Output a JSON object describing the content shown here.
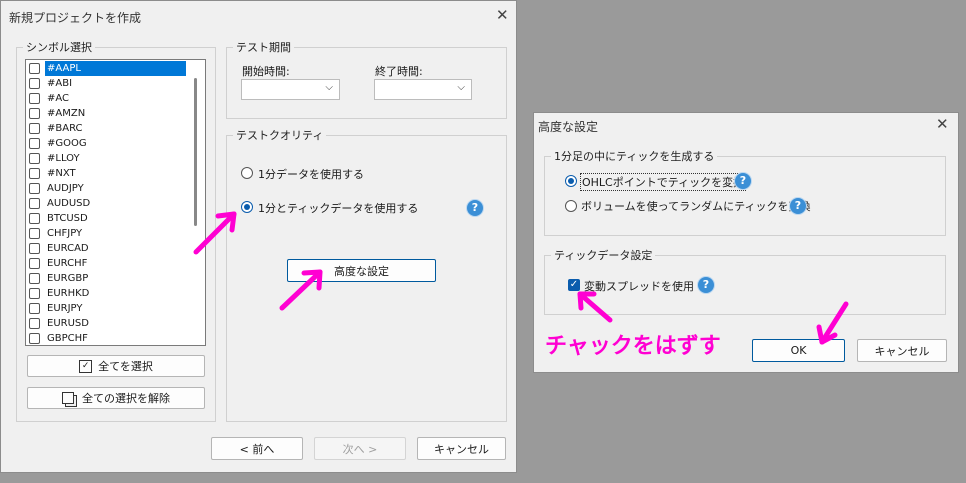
{
  "main_window": {
    "title": "新規プロジェクトを作成",
    "symbol_group_label": "シンボル選択",
    "symbols": [
      "#AAPL",
      "#ABI",
      "#AC",
      "#AMZN",
      "#BARC",
      "#GOOG",
      "#LLOY",
      "#NXT",
      "AUDJPY",
      "AUDUSD",
      "BTCUSD",
      "CHFJPY",
      "EURCAD",
      "EURCHF",
      "EURGBP",
      "EURHKD",
      "EURJPY",
      "EURUSD",
      "GBPCHF"
    ],
    "selected_symbol": "#AAPL",
    "select_all_label": "全てを選択",
    "deselect_all_label": "全ての選択を解除",
    "test_period": {
      "group_label": "テスト期間",
      "start_label": "開始時間:",
      "end_label": "終了時間:"
    },
    "test_quality": {
      "group_label": "テストクオリティ",
      "option1": "1分データを使用する",
      "option2": "1分とティックデータを使用する",
      "selected": "option2",
      "advanced_button": "高度な設定"
    },
    "footer": {
      "back": "< 前へ",
      "next": "次へ >",
      "cancel": "キャンセル"
    }
  },
  "advanced_dialog": {
    "title": "高度な設定",
    "group1_label": "1分足の中にティックを生成する",
    "option_ohlc": "OHLCポイントでティックを変換",
    "option_random": "ボリュームを使ってランダムにティックを変換",
    "selected_option": "option_ohlc",
    "group2_label": "ティックデータ設定",
    "variable_spread_label": "変動スプレッドを使用",
    "variable_spread_checked": true,
    "ok": "OK",
    "cancel": "キャンセル"
  },
  "annotation": {
    "text": "チャックをはずす",
    "color": "#ff00d2"
  },
  "icons": {
    "help": "?",
    "close": "✕",
    "chevron": "⌵",
    "check": "✓"
  }
}
